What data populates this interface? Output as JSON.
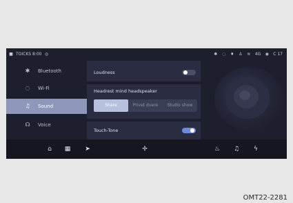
{
  "status": {
    "left_text": "TOICKS 8:00",
    "icons_left": [
      "car-icon",
      "profile-icon"
    ],
    "icons_right": [
      "bluetooth-icon",
      "signal-icon",
      "volume-icon",
      "person-icon",
      "wifi-icon",
      "lte-icon",
      "location-icon",
      "temperature-icon"
    ],
    "temp": "C 17",
    "network": "4G"
  },
  "sidebar": {
    "items": [
      {
        "label": "Bluetooth",
        "icon": "✱"
      },
      {
        "label": "Wi-Fi",
        "icon": "◌"
      },
      {
        "label": "Sound",
        "icon": "♫"
      },
      {
        "label": "Voice",
        "icon": "☊"
      }
    ]
  },
  "panel": {
    "loudness_label": "Loudness",
    "loudness_on": false,
    "headrest_label": "Headrest mind headspeaker",
    "modes": [
      "Share",
      "Privet dvere",
      "Studio show"
    ],
    "selected_mode": "Share",
    "touchtone_label": "Touch-Tone",
    "touchtone_on": true
  },
  "dock": {
    "items": [
      "home-icon",
      "apps-icon",
      "navigation-icon",
      "fan-icon",
      "seat-heat-icon",
      "music-icon",
      "bolt-icon"
    ]
  },
  "caption": "OMT22-2281",
  "colors": {
    "screen_bg": "#1d1f2e",
    "panel_bg": "#2a2d42",
    "active_nav": "#8f98ba",
    "toggle_on": "#6c8bd9"
  }
}
